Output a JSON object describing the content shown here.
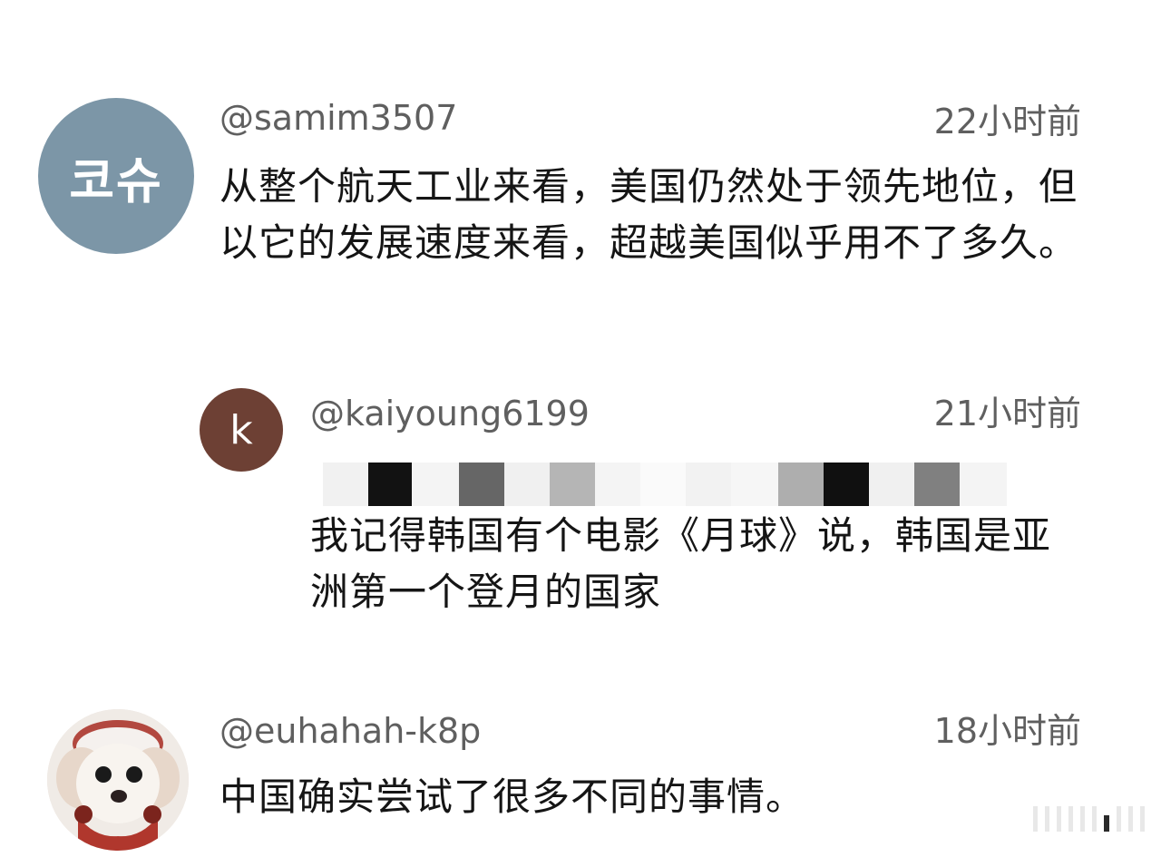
{
  "comments": [
    {
      "avatar_text": "코슈",
      "avatar_color": "#7c96a7",
      "username": "@samim3507",
      "time": "22小时前",
      "text": "从整个航天工业来看，美国仍然处于领先地位，但以它的发展速度来看，超越美国似乎用不了多久。"
    },
    {
      "avatar_text": "k",
      "avatar_color": "#6d4034",
      "username": "@kaiyoung6199",
      "time": "21小时前",
      "text": "我记得韩国有个电影《月球》说，韩国是亚洲第一个登月的国家"
    },
    {
      "avatar_icon": "puppy-avatar-icon",
      "username": "@euhahah-k8p",
      "time": "18小时前",
      "text": "中国确实尝试了很多不同的事情。"
    }
  ],
  "colors": {
    "meta": "#5f5f5f",
    "text": "#151515",
    "background": "#ffffff"
  }
}
